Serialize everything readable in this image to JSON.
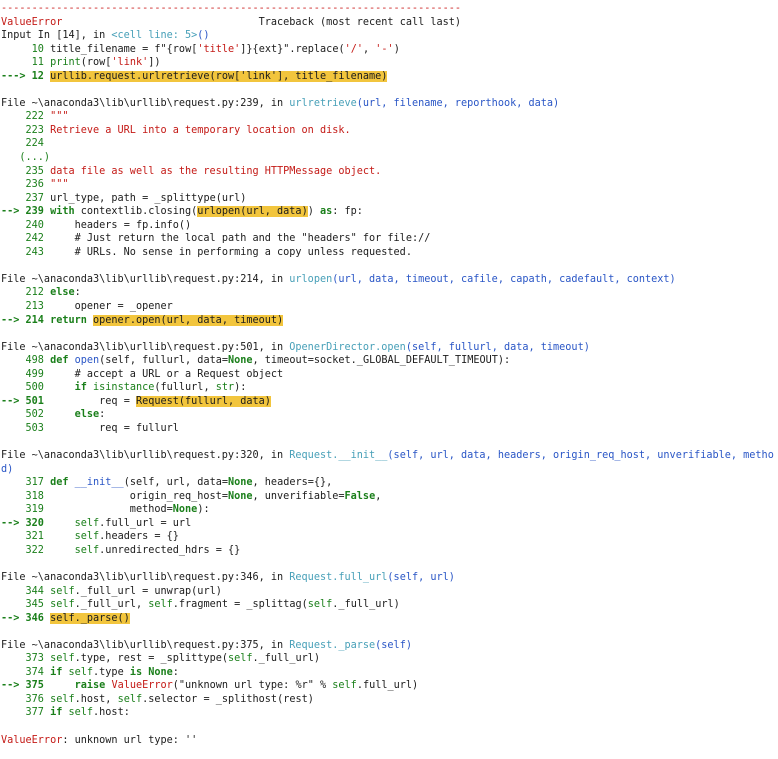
{
  "traceback": {
    "separator": "---------------------------------------------------------------------------",
    "error_type": "ValueError",
    "header_gap": "                                ",
    "header_label": "Traceback (most recent call last)",
    "frames": [
      {
        "prefix": "Input In [14], in ",
        "location": "<cell line: 5>",
        "call_parens": "()",
        "lines": [
          [
            [
              "green",
              "     10 "
            ],
            [
              "",
              "title_filename "
            ],
            [
              "",
              "= "
            ],
            [
              "",
              "f\""
            ],
            [
              "",
              "{"
            ],
            [
              "",
              "row["
            ],
            [
              "red",
              "'title'"
            ],
            [
              "",
              "]"
            ],
            [
              "",
              "}{"
            ],
            [
              "",
              "ext"
            ],
            [
              "",
              "}"
            ],
            [
              "",
              "\".replace("
            ],
            [
              "red",
              "'/'"
            ],
            [
              "",
              ", "
            ],
            [
              "red",
              "'-'"
            ],
            [
              "",
              ")"
            ]
          ],
          [
            [
              "green",
              "     11 "
            ],
            [
              "green",
              "print"
            ],
            [
              "",
              "(row["
            ],
            [
              "red",
              "'link'"
            ],
            [
              "",
              "])"
            ]
          ],
          [
            [
              "bgreen",
              "---> 12 "
            ],
            [
              "hl",
              "urllib.request.urlretrieve(row['link'], title_filename)"
            ]
          ]
        ]
      },
      {
        "prefix": "File ~\\anaconda3\\lib\\urllib\\request.py:239, in ",
        "location": "urlretrieve",
        "call_parens": "(url, filename, reporthook, data)",
        "lines": [
          [
            [
              "green",
              "    222 "
            ],
            [
              "red",
              "\"\"\""
            ]
          ],
          [
            [
              "green",
              "    223 "
            ],
            [
              "red",
              "Retrieve a URL into a temporary location on disk."
            ]
          ],
          [
            [
              "green",
              "    224 "
            ]
          ],
          [
            [
              "green",
              "   (...)"
            ]
          ],
          [
            [
              "green",
              "    235 "
            ],
            [
              "red",
              "data file as well as the resulting HTTPMessage object."
            ]
          ],
          [
            [
              "green",
              "    236 "
            ],
            [
              "red",
              "\"\"\""
            ]
          ],
          [
            [
              "green",
              "    237 "
            ],
            [
              "",
              "url_type, path "
            ],
            [
              "",
              "= "
            ],
            [
              "",
              "_splittype(url)"
            ]
          ],
          [
            [
              "bgreen",
              "--> 239 "
            ],
            [
              "bgreen",
              "with "
            ],
            [
              "",
              "contextlib.closing("
            ],
            [
              "hl",
              "urlopen(url, data)"
            ],
            [
              "",
              ") "
            ],
            [
              "bgreen",
              "as"
            ],
            [
              "",
              ": fp:"
            ]
          ],
          [
            [
              "green",
              "    240 "
            ],
            [
              "",
              "    headers "
            ],
            [
              "",
              "= "
            ],
            [
              "",
              "fp.info()"
            ]
          ],
          [
            [
              "green",
              "    242 "
            ],
            [
              "",
              "    # Just return the local path and the \"headers\" for file://"
            ]
          ],
          [
            [
              "green",
              "    243 "
            ],
            [
              "",
              "    # URLs. No sense in performing a copy unless requested."
            ]
          ]
        ]
      },
      {
        "prefix": "File ~\\anaconda3\\lib\\urllib\\request.py:214, in ",
        "location": "urlopen",
        "call_parens": "(url, data, timeout, cafile, capath, cadefault, context)",
        "lines": [
          [
            [
              "green",
              "    212 "
            ],
            [
              "bgreen",
              "else"
            ],
            [
              "",
              ":"
            ]
          ],
          [
            [
              "green",
              "    213 "
            ],
            [
              "",
              "    opener "
            ],
            [
              "",
              "= "
            ],
            [
              "",
              "_opener"
            ]
          ],
          [
            [
              "bgreen",
              "--> 214 "
            ],
            [
              "bgreen",
              "return "
            ],
            [
              "hl",
              "opener.open(url, data, timeout)"
            ]
          ]
        ]
      },
      {
        "prefix": "File ~\\anaconda3\\lib\\urllib\\request.py:501, in ",
        "location": "OpenerDirector.open",
        "call_parens": "(self, fullurl, data, timeout)",
        "lines": [
          [
            [
              "green",
              "    498 "
            ],
            [
              "bgreen",
              "def "
            ],
            [
              "blue",
              "open"
            ],
            [
              "",
              "(self, fullurl, data"
            ],
            [
              "",
              "="
            ],
            [
              "bgreen",
              "None"
            ],
            [
              "",
              ", timeout"
            ],
            [
              "",
              "="
            ],
            [
              "",
              "socket._GLOBAL_DEFAULT_TIMEOUT):"
            ]
          ],
          [
            [
              "green",
              "    499 "
            ],
            [
              "",
              "    # accept a URL or a Request object"
            ]
          ],
          [
            [
              "green",
              "    500 "
            ],
            [
              "",
              "    "
            ],
            [
              "bgreen",
              "if "
            ],
            [
              "green",
              "isinstance"
            ],
            [
              "",
              "(fullurl, "
            ],
            [
              "green",
              "str"
            ],
            [
              "",
              "):"
            ]
          ],
          [
            [
              "bgreen",
              "--> 501 "
            ],
            [
              "",
              "        req "
            ],
            [
              "",
              "= "
            ],
            [
              "hl",
              "Request(fullurl, data)"
            ]
          ],
          [
            [
              "green",
              "    502 "
            ],
            [
              "",
              "    "
            ],
            [
              "bgreen",
              "else"
            ],
            [
              "",
              ":"
            ]
          ],
          [
            [
              "green",
              "    503 "
            ],
            [
              "",
              "        req "
            ],
            [
              "",
              "= "
            ],
            [
              "",
              "fullurl"
            ]
          ]
        ]
      },
      {
        "prefix": "File ~\\anaconda3\\lib\\urllib\\request.py:320, in ",
        "location": "Request.__init__",
        "call_parens": "(self, url, data, headers, origin_req_host, unverifiable, metho",
        "wrap": "d)",
        "lines": [
          [
            [
              "green",
              "    317 "
            ],
            [
              "bgreen",
              "def "
            ],
            [
              "blue",
              "__init__"
            ],
            [
              "",
              "(self, url, data"
            ],
            [
              "",
              "="
            ],
            [
              "bgreen",
              "None"
            ],
            [
              "",
              ", headers"
            ],
            [
              "",
              "="
            ],
            [
              "",
              "{},"
            ]
          ],
          [
            [
              "green",
              "    318 "
            ],
            [
              "",
              "             origin_req_host"
            ],
            [
              "",
              "="
            ],
            [
              "bgreen",
              "None"
            ],
            [
              "",
              ", unverifiable"
            ],
            [
              "",
              "="
            ],
            [
              "bgreen",
              "False"
            ],
            [
              "",
              ","
            ]
          ],
          [
            [
              "green",
              "    319 "
            ],
            [
              "",
              "             method"
            ],
            [
              "",
              "="
            ],
            [
              "bgreen",
              "None"
            ],
            [
              "",
              "):"
            ]
          ],
          [
            [
              "bgreen",
              "--> 320 "
            ],
            [
              "",
              "    "
            ],
            [
              "green",
              "self"
            ],
            [
              "",
              ".full_url "
            ],
            [
              "",
              "= "
            ],
            [
              "",
              "url"
            ]
          ],
          [
            [
              "green",
              "    321 "
            ],
            [
              "",
              "    "
            ],
            [
              "green",
              "self"
            ],
            [
              "",
              ".headers "
            ],
            [
              "",
              "= "
            ],
            [
              "",
              "{}"
            ]
          ],
          [
            [
              "green",
              "    322 "
            ],
            [
              "",
              "    "
            ],
            [
              "green",
              "self"
            ],
            [
              "",
              ".unredirected_hdrs "
            ],
            [
              "",
              "= "
            ],
            [
              "",
              "{}"
            ]
          ]
        ]
      },
      {
        "prefix": "File ~\\anaconda3\\lib\\urllib\\request.py:346, in ",
        "location": "Request.full_url",
        "call_parens": "(self, url)",
        "lines": [
          [
            [
              "green",
              "    344 "
            ],
            [
              "green",
              "self"
            ],
            [
              "",
              "._full_url "
            ],
            [
              "",
              "= "
            ],
            [
              "",
              "unwrap(url)"
            ]
          ],
          [
            [
              "green",
              "    345 "
            ],
            [
              "green",
              "self"
            ],
            [
              "",
              "._full_url, "
            ],
            [
              "green",
              "self"
            ],
            [
              "",
              ".fragment "
            ],
            [
              "",
              "= "
            ],
            [
              "",
              "_splittag("
            ],
            [
              "green",
              "self"
            ],
            [
              "",
              "._full_url)"
            ]
          ],
          [
            [
              "bgreen",
              "--> 346 "
            ],
            [
              "hl",
              "self._parse()"
            ]
          ]
        ]
      },
      {
        "prefix": "File ~\\anaconda3\\lib\\urllib\\request.py:375, in ",
        "location": "Request._parse",
        "call_parens": "(self)",
        "lines": [
          [
            [
              "green",
              "    373 "
            ],
            [
              "green",
              "self"
            ],
            [
              "",
              ".type, rest "
            ],
            [
              "",
              "= "
            ],
            [
              "",
              "_splittype("
            ],
            [
              "green",
              "self"
            ],
            [
              "",
              "._full_url)"
            ]
          ],
          [
            [
              "green",
              "    374 "
            ],
            [
              "bgreen",
              "if "
            ],
            [
              "green",
              "self"
            ],
            [
              "",
              ".type "
            ],
            [
              "bgreen",
              "is "
            ],
            [
              "bgreen",
              "None"
            ],
            [
              "",
              ":"
            ]
          ],
          [
            [
              "bgreen",
              "--> 375 "
            ],
            [
              "",
              "    "
            ],
            [
              "bgreen",
              "raise "
            ],
            [
              "red",
              "ValueError"
            ],
            [
              "",
              "(\"unknown url type: %r\" "
            ],
            [
              "",
              "% "
            ],
            [
              "green",
              "self"
            ],
            [
              "",
              ".full_url)"
            ]
          ],
          [
            [
              "green",
              "    376 "
            ],
            [
              "green",
              "self"
            ],
            [
              "",
              ".host, "
            ],
            [
              "green",
              "self"
            ],
            [
              "",
              ".selector "
            ],
            [
              "",
              "= "
            ],
            [
              "",
              "_splithost(rest)"
            ]
          ],
          [
            [
              "green",
              "    377 "
            ],
            [
              "bgreen",
              "if "
            ],
            [
              "green",
              "self"
            ],
            [
              "",
              ".host:"
            ]
          ]
        ]
      }
    ],
    "final_error": {
      "type": "ValueError",
      "message": ": unknown url type: ''"
    }
  }
}
